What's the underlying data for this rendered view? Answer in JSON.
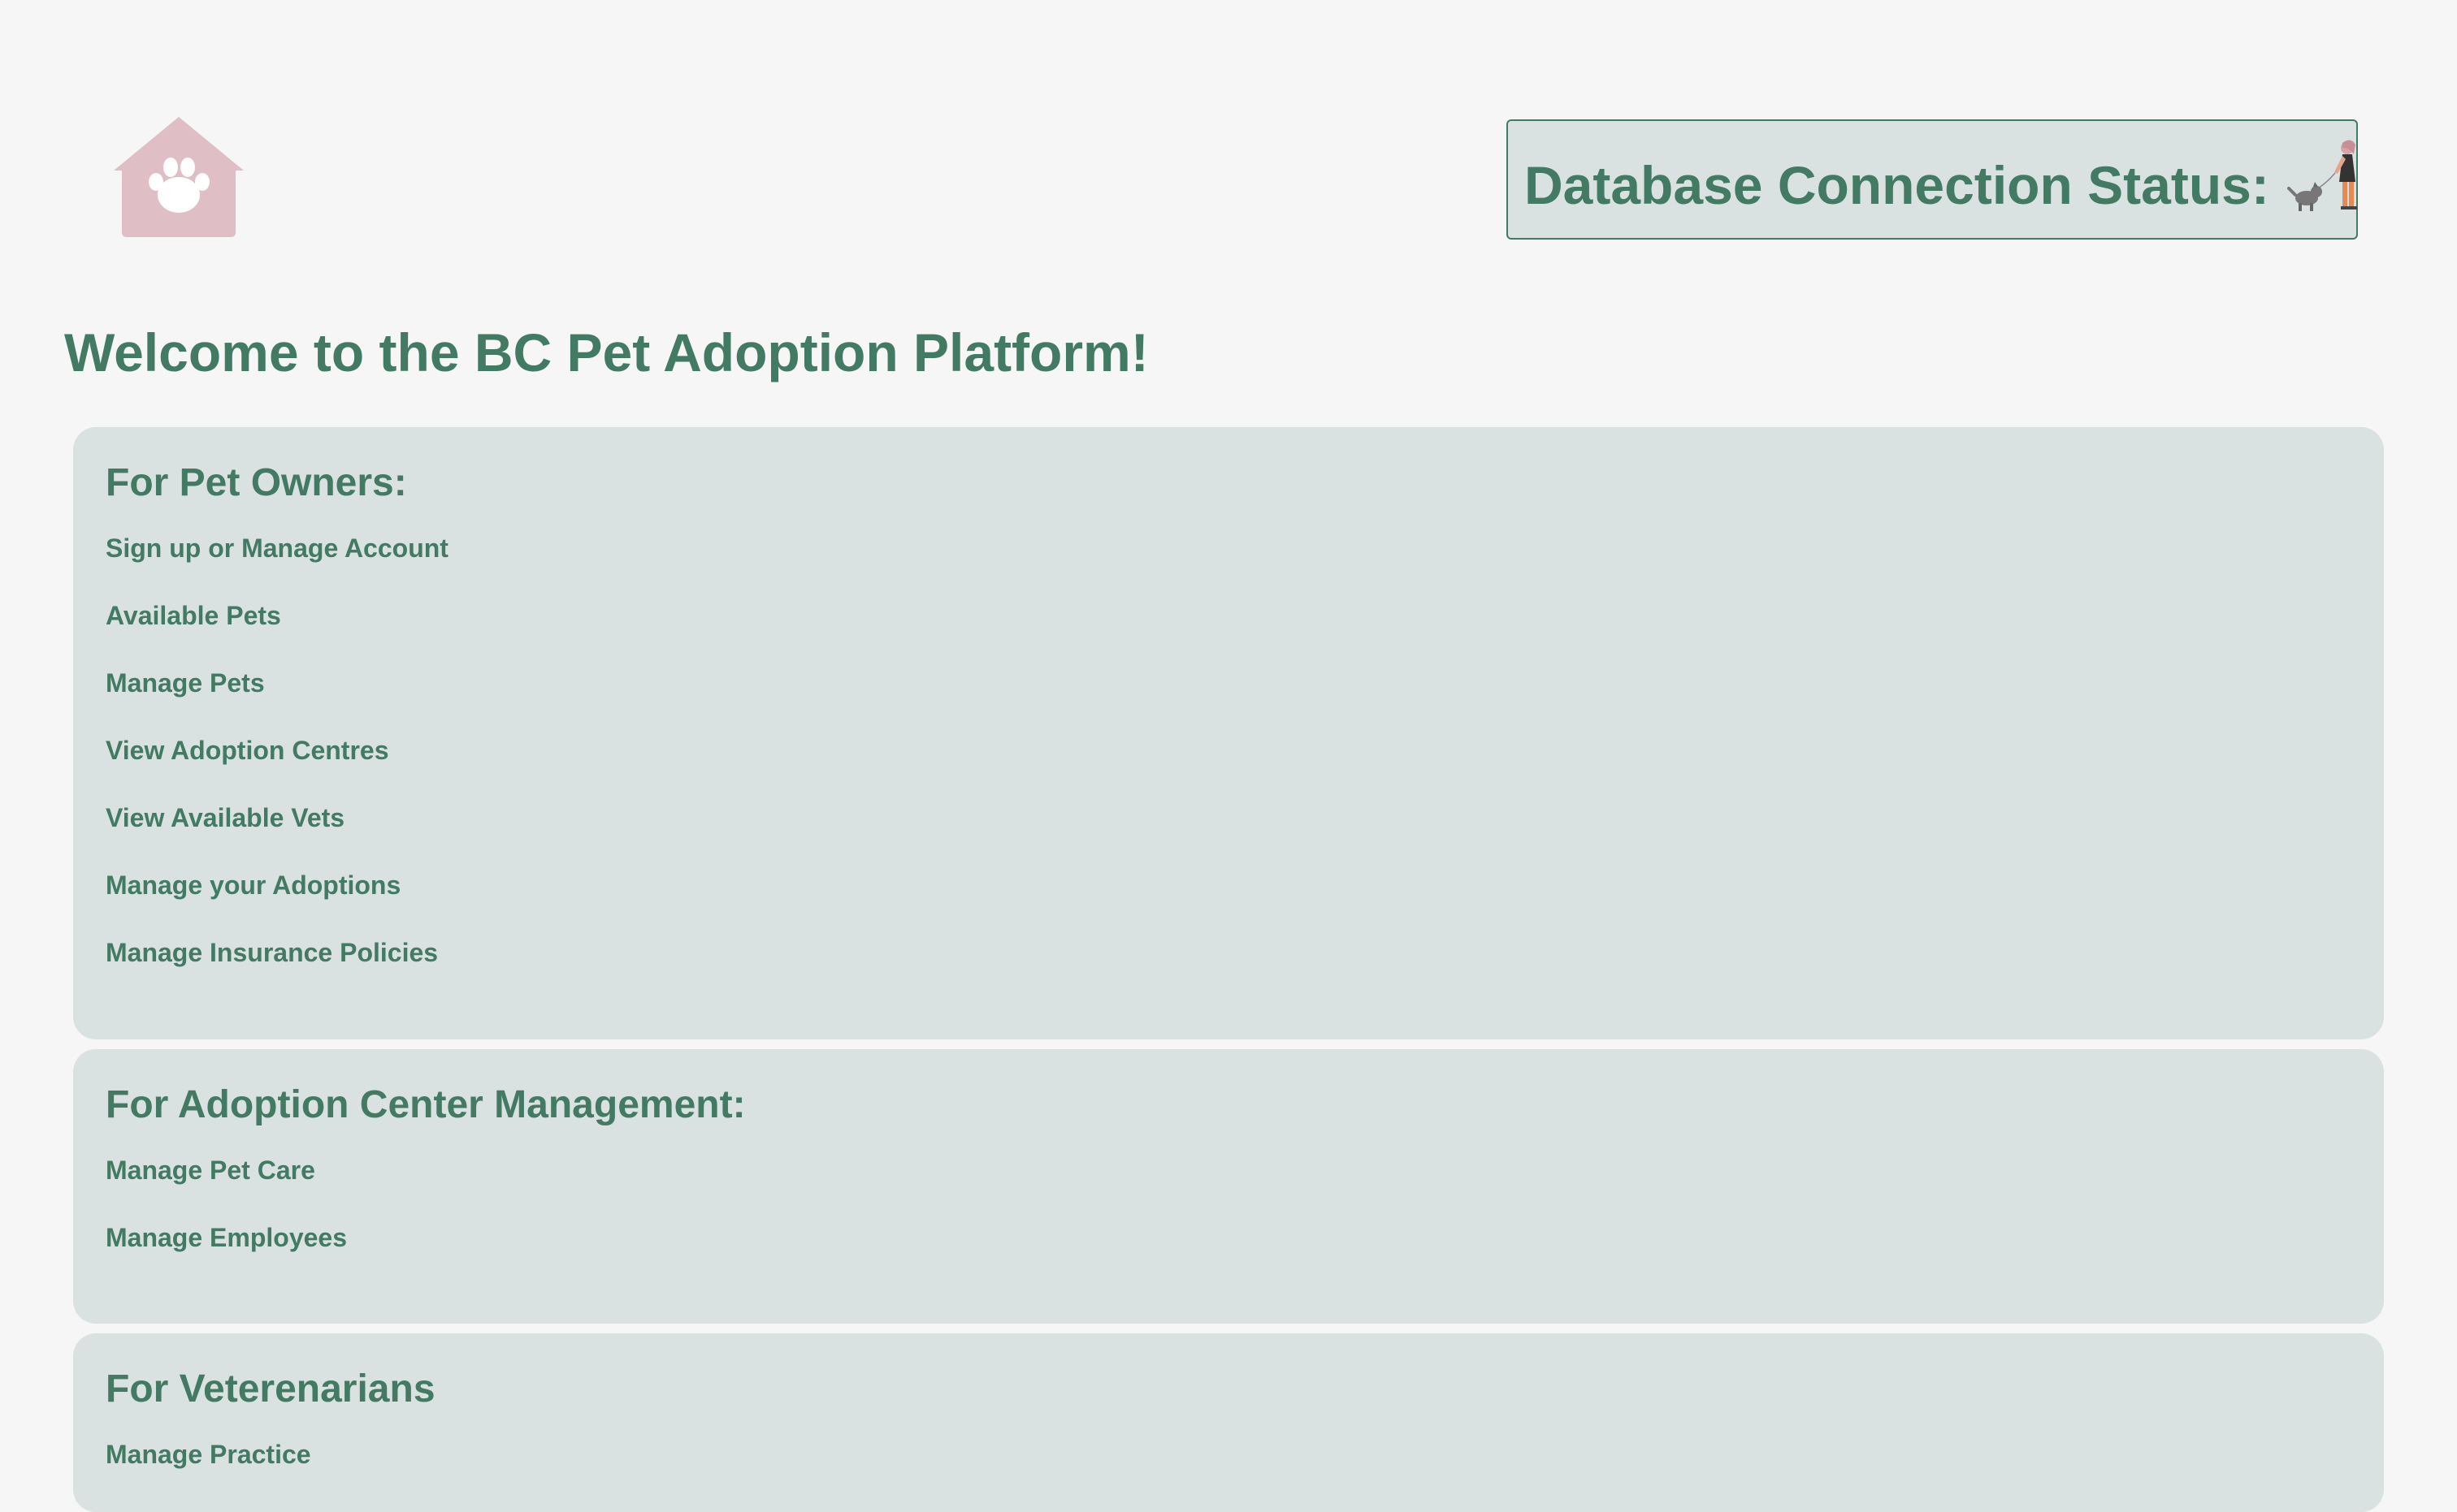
{
  "header": {
    "logo_icon": "paw-house-icon",
    "status_label": "Database Connection Status:",
    "status_icon": "person-walking-dog-icon"
  },
  "page": {
    "title": "Welcome to the BC Pet Adoption Platform!"
  },
  "sections": [
    {
      "title": "For Pet Owners:",
      "links": [
        "Sign up or Manage Account",
        "Available Pets",
        "Manage Pets",
        "View Adoption Centres",
        "View Available Vets",
        "Manage your Adoptions",
        "Manage Insurance Policies"
      ]
    },
    {
      "title": "For Adoption Center Management:",
      "links": [
        "Manage Pet Care",
        "Manage Employees"
      ]
    },
    {
      "title": "For Veterenarians",
      "links": [
        "Manage Practice"
      ]
    }
  ],
  "colors": {
    "background": "#f6f6f6",
    "panel": "#d9e2e0",
    "accent_green": "#427a63",
    "logo_pink": "#e0bec5"
  }
}
